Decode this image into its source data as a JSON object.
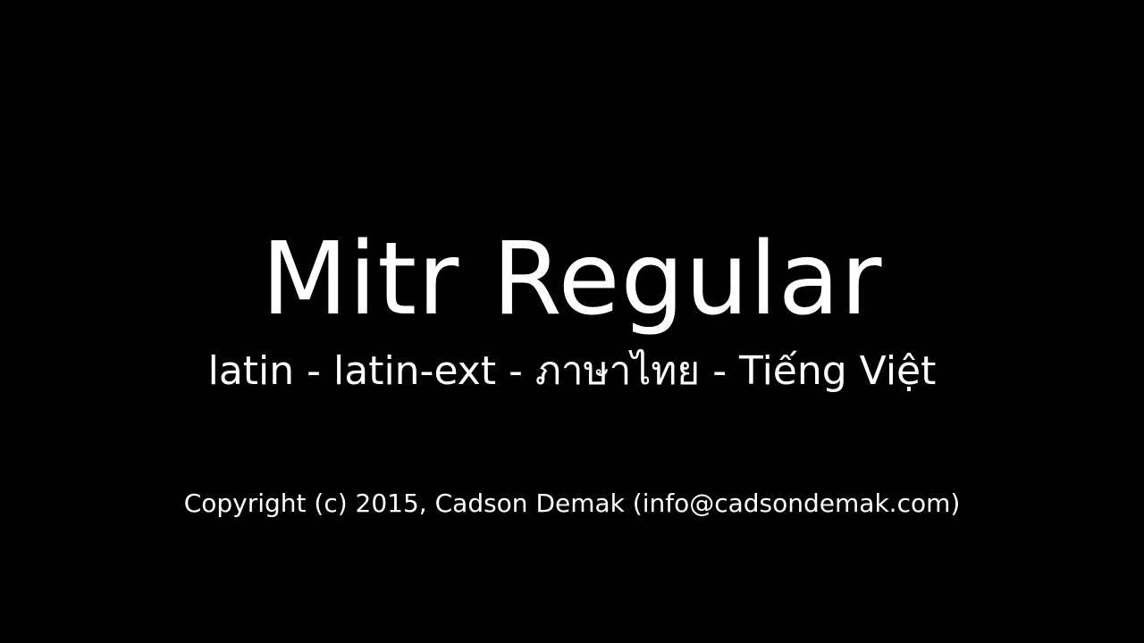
{
  "specimen": {
    "title": "Mitr Regular",
    "scripts": "latin - latin-ext - ภาษาไทย - Tiếng Việt",
    "copyright": "Copyright (c) 2015, Cadson Demak (info@cadsondemak.com)"
  },
  "colors": {
    "background": "#000000",
    "text": "#ffffff"
  }
}
